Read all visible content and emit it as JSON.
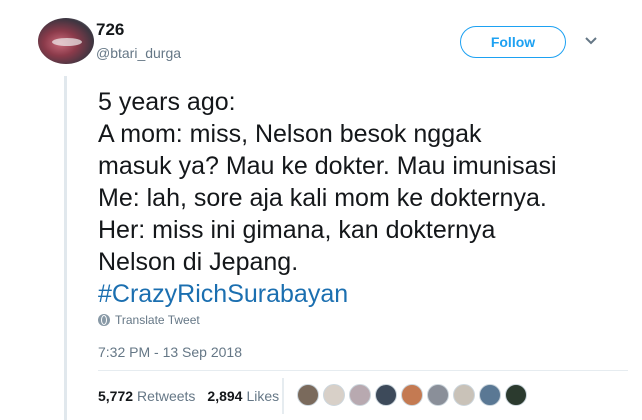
{
  "user": {
    "display_name": "726",
    "handle": "@btari_durga",
    "avatar_icon": "user-avatar"
  },
  "actions": {
    "follow_label": "Follow",
    "menu_icon": "chevron-down-icon"
  },
  "tweet": {
    "text": "5 years ago:\nA mom: miss, Nelson besok nggak\nmasuk ya? Mau ke dokter. Mau imunisasi\nMe: lah, sore aja kali mom ke dokternya.\nHer: miss ini gimana, kan dokternya\nNelson di Jepang.",
    "hashtag": "#CrazyRichSurabayan",
    "translate_label": "Translate Tweet",
    "timestamp": "7:32 PM - 13 Sep 2018"
  },
  "stats": {
    "retweets_count": "5,772",
    "retweets_label": "Retweets",
    "likes_count": "2,894",
    "likes_label": "Likes"
  },
  "likers": {
    "colors": [
      "#7a6a5c",
      "#d8d0c8",
      "#b8a9b0",
      "#3d4a5a",
      "#c47a52",
      "#8a8f99",
      "#c9c2b8",
      "#5a7894",
      "#2b3a2e"
    ]
  },
  "colors": {
    "accent": "#1da1f2",
    "hashtag": "#1b6fb0",
    "muted": "#657786"
  }
}
